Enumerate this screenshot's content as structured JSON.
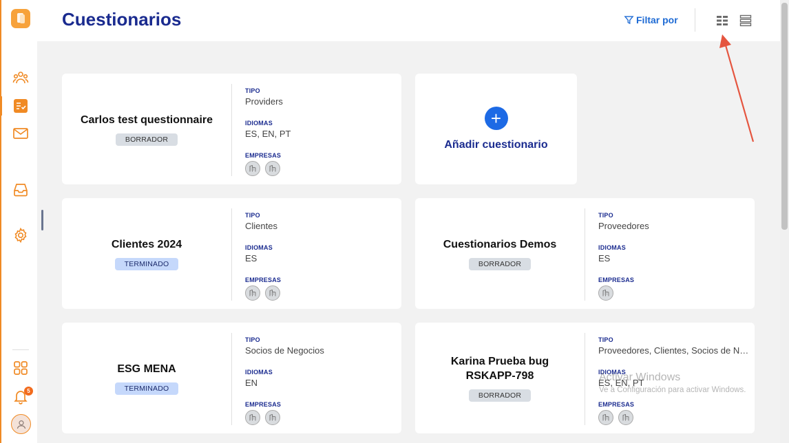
{
  "header": {
    "title": "Cuestionarios",
    "filter_label": "Filtar por"
  },
  "sidebar": {
    "notification_count": "5"
  },
  "cards": [
    {
      "name": "Carlos test questionnaire",
      "status": "BORRADOR",
      "tipo": "Providers",
      "idiomas": "ES, EN, PT",
      "empresas_count": 2
    },
    {
      "name": "Clientes 2024",
      "status": "TERMINADO",
      "tipo": "Clientes",
      "idiomas": "ES",
      "empresas_count": 2
    },
    {
      "name": "Cuestionarios Demos",
      "status": "BORRADOR",
      "tipo": "Proveedores",
      "idiomas": "ES",
      "empresas_count": 1
    },
    {
      "name": "ESG MENA",
      "status": "TERMINADO",
      "tipo": "Socios de Negocios",
      "idiomas": "EN",
      "empresas_count": 2
    },
    {
      "name": "Karina Prueba bug RSKAPP-798",
      "status": "BORRADOR",
      "tipo": "Proveedores, Clientes, Socios de N…",
      "idiomas": "ES, EN, PT",
      "empresas_count": 2
    }
  ],
  "labels": {
    "tipo": "TIPO",
    "idiomas": "IDIOMAS",
    "empresas": "EMPRESAS"
  },
  "add_card": {
    "label": "Añadir cuestionario"
  },
  "watermark": {
    "title": "Activar Windows",
    "subtitle": "Ve a Configuración para activar Windows."
  },
  "colors": {
    "accent": "#f08a24",
    "title_blue": "#1a2b8f",
    "link_blue": "#1d6ad4",
    "draft_badge": "#d8dde3",
    "done_badge": "#c5d8fb",
    "annotation_arrow": "#e5553f"
  }
}
